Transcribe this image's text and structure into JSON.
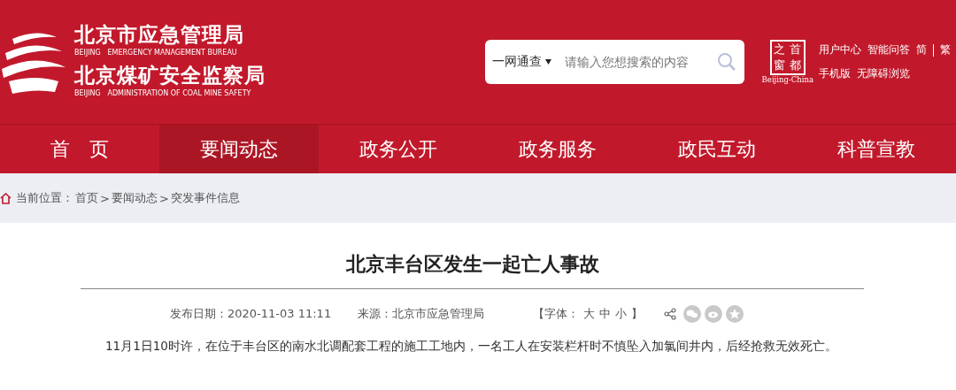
{
  "header": {
    "titles": [
      {
        "zh": "北京市应急管理局",
        "en": "BEIJING   EMERGENCY MANAGEMENT BUREAU"
      },
      {
        "zh": "北京煤矿安全监察局",
        "en": "BEIJING   ADMINISTRATION OF COAL MINE SAFETY"
      }
    ],
    "search": {
      "scope": "一网通查",
      "placeholder": "请输入您想搜索的内容"
    },
    "capital_badge": {
      "chars": [
        "之",
        "首",
        "窗",
        "都"
      ],
      "caption": "Beijing-China"
    },
    "links": [
      [
        "用户中心",
        "智能问答"
      ],
      [
        "手机版",
        "无障碍浏览"
      ]
    ],
    "languages": [
      "简",
      "繁"
    ]
  },
  "nav": [
    {
      "label": "首　页",
      "selected": false
    },
    {
      "label": "要闻动态",
      "selected": true
    },
    {
      "label": "政务公开",
      "selected": false
    },
    {
      "label": "政务服务",
      "selected": false
    },
    {
      "label": "政民互动",
      "selected": false
    },
    {
      "label": "科普宣教",
      "selected": false
    }
  ],
  "breadcrumb": {
    "label": "当前位置：",
    "separator": ">",
    "items": [
      "首页",
      "要闻动态",
      "突发事件信息"
    ]
  },
  "article": {
    "title": "北京丰台区发生一起亡人事故",
    "published": "发布日期：2020-11-03 11:11",
    "source": "来源：北京市应急管理局",
    "font_size": {
      "open": "【字体：",
      "options": [
        "大",
        "中",
        "小"
      ],
      "close": "】"
    },
    "body": "11月1日10时许，在位于丰台区的南水北调配套工程的施工工地内，一名工人在安装栏杆时不慎坠入加氯间井内，后经抢救无效死亡。"
  }
}
